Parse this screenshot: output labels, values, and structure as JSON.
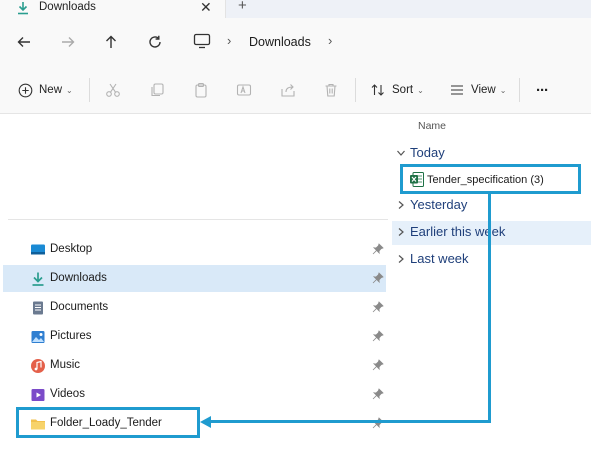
{
  "tab": {
    "title": "Downloads",
    "close_glyph": "✕",
    "new_tab_glyph": "+",
    "icon": "download-icon"
  },
  "nav": {
    "back_icon": "arrow-left-icon",
    "forward_icon": "arrow-right-icon",
    "up_icon": "arrow-up-icon",
    "refresh_icon": "refresh-icon",
    "breadcrumb": {
      "root_icon": "monitor-icon",
      "separator": "›",
      "current": "Downloads"
    }
  },
  "toolbar": {
    "new_label": "New",
    "sort_label": "Sort",
    "view_label": "View",
    "more_glyph": "···",
    "caret": "⌄"
  },
  "sidebar": {
    "items": [
      {
        "label": "Desktop",
        "icon": "desktop-icon",
        "color": "#1a8ad4"
      },
      {
        "label": "Downloads",
        "icon": "download-icon",
        "color": "#2a9d8f",
        "selected": true
      },
      {
        "label": "Documents",
        "icon": "document-icon",
        "color": "#6b7a90"
      },
      {
        "label": "Pictures",
        "icon": "picture-icon",
        "color": "#2f7fd1"
      },
      {
        "label": "Music",
        "icon": "music-icon",
        "color": "#e4604a"
      },
      {
        "label": "Videos",
        "icon": "video-icon",
        "color": "#7b4bc9"
      },
      {
        "label": "Folder_Loady_Tender",
        "icon": "folder-icon",
        "color": "#f2c14e"
      }
    ]
  },
  "content": {
    "column_header": "Name",
    "groups": [
      {
        "label": "Today",
        "expanded": true
      },
      {
        "label": "Yesterday",
        "expanded": false
      },
      {
        "label": "Earlier this week",
        "expanded": false
      },
      {
        "label": "Last week",
        "expanded": false
      }
    ],
    "file": {
      "label": "Tender_specification (3)",
      "icon": "excel-file-icon",
      "color": "#1e7145"
    }
  },
  "colors": {
    "accent": "#1f9bcf",
    "selection": "#d9e9f8",
    "group_text": "#1f3f7a"
  }
}
